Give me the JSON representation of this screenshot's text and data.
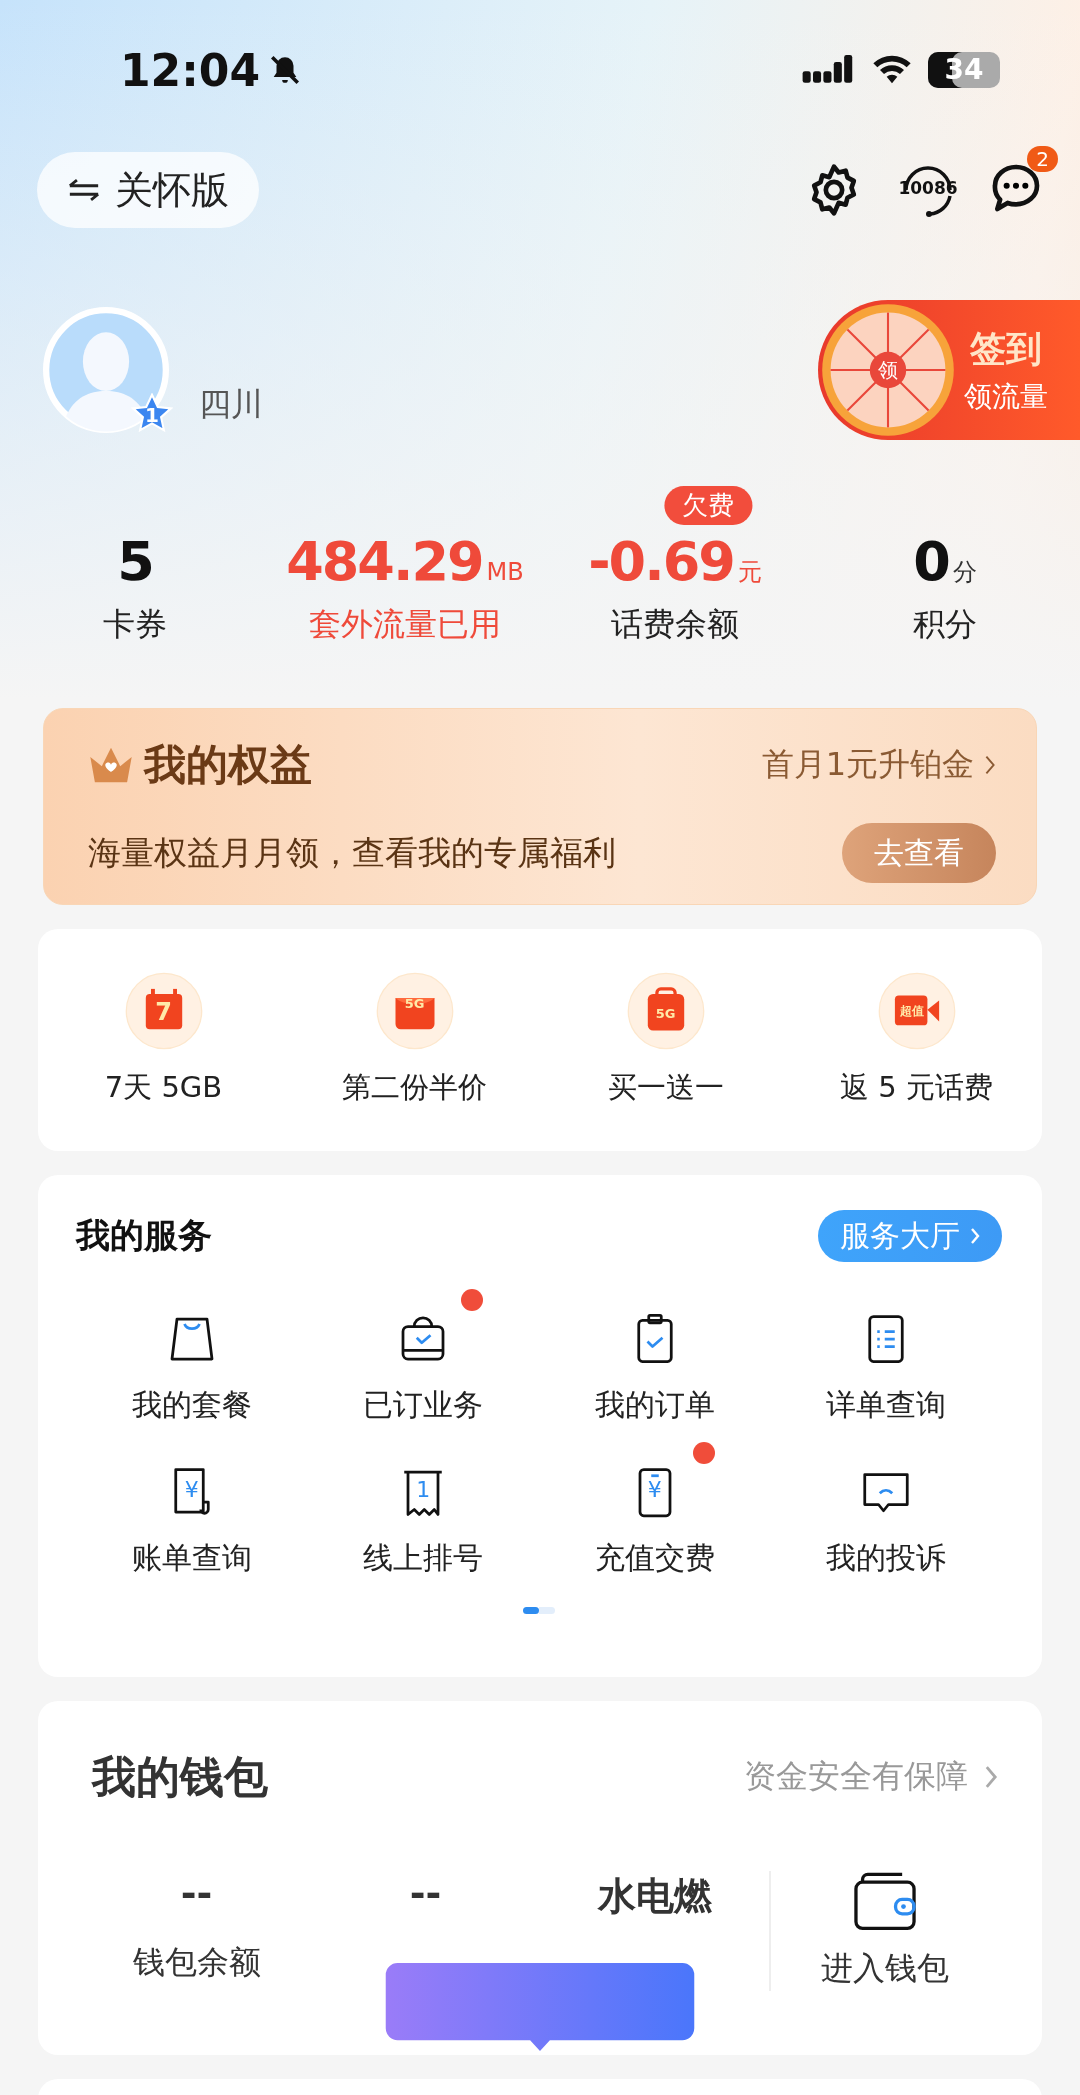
{
  "status_bar": {
    "time": "12:04",
    "battery": "34"
  },
  "header": {
    "care_button": "关怀版",
    "hotline": "10086",
    "message_badge": "2"
  },
  "profile": {
    "level": "1",
    "region": "四川",
    "sign_in": {
      "wheel_label": "领",
      "title": "签到",
      "subtitle": "领流量"
    }
  },
  "stats": [
    {
      "value": "5",
      "label": "卡券",
      "alert": false
    },
    {
      "value": "484.29",
      "unit": "MB",
      "label": "套外流量已用",
      "alert": true
    },
    {
      "value": "-0.69",
      "unit": "元",
      "label": "话费余额",
      "alert": true,
      "badge": "欠费"
    },
    {
      "value": "0",
      "unit": "分",
      "label": "积分",
      "alert": false
    }
  ],
  "benefits": {
    "title": "我的权益",
    "link": "首月1元升铂金",
    "text": "海量权益月月领，查看我的专属福利",
    "button": "去查看"
  },
  "promos": [
    {
      "kind": "calendar",
      "icon_text": "7",
      "label": "7天 5GB"
    },
    {
      "kind": "pouch",
      "icon_text": "5G",
      "label": "第二份半价"
    },
    {
      "kind": "bag",
      "icon_text": "5G",
      "label": "买一送一"
    },
    {
      "kind": "video",
      "icon_text": "超值",
      "label": "返 5 元话费"
    }
  ],
  "services": {
    "title": "我的服务",
    "button": "服务大厅",
    "items": [
      {
        "kind": "bag",
        "label": "我的套餐",
        "dot": false
      },
      {
        "kind": "case",
        "label": "已订业务",
        "dot": true
      },
      {
        "kind": "clipboard",
        "label": "我的订单",
        "dot": false
      },
      {
        "kind": "list",
        "label": "详单查询",
        "dot": false
      },
      {
        "kind": "bill",
        "icon_text": "¥",
        "label": "账单查询",
        "dot": false
      },
      {
        "kind": "ticket",
        "icon_text": "1",
        "label": "线上排号",
        "dot": false
      },
      {
        "kind": "phone",
        "icon_text": "¥",
        "label": "充值交费",
        "dot": true
      },
      {
        "kind": "chat",
        "label": "我的投诉",
        "dot": false
      }
    ],
    "pages": [
      {
        "selected": true
      },
      {
        "selected": false
      }
    ]
  },
  "wallet": {
    "title": "我的钱包",
    "link": "资金安全有保障",
    "items": [
      {
        "value": "--",
        "label": "钱包余额"
      },
      {
        "value": "--"
      },
      {
        "value": "水电燃"
      }
    ],
    "enter": "进入钱包"
  }
}
